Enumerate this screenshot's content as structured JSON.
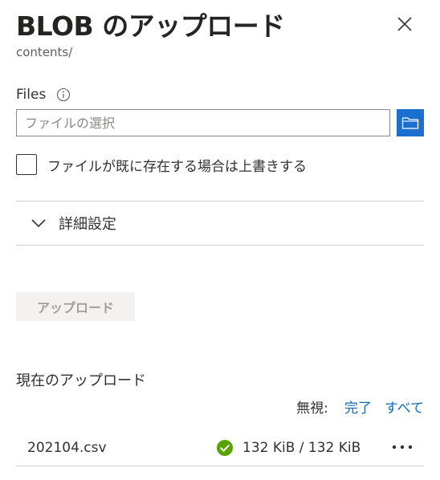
{
  "header": {
    "title": "BLOB のアップロード",
    "subtitle": "contents/",
    "close_icon": "close-icon"
  },
  "files": {
    "label": "Files",
    "info_icon": "info-icon",
    "placeholder": "ファイルの選択",
    "value": "",
    "browse_icon": "folder-icon",
    "accent_color": "#1a6fd0"
  },
  "overwrite": {
    "label": "ファイルが既に存在する場合は上書きする",
    "checked": false
  },
  "advanced": {
    "label": "詳細設定",
    "expanded": false,
    "chevron_icon": "chevron-down-icon"
  },
  "upload_button": {
    "label": "アップロード",
    "enabled": false
  },
  "current_uploads": {
    "title": "現在のアップロード",
    "dismiss_label": "無視:",
    "dismiss_completed": "完了",
    "dismiss_all": "すべて",
    "items": [
      {
        "name": "202104.csv",
        "status": "completed",
        "status_icon": "check-circle-icon",
        "status_color": "#57a300",
        "progress": "132 KiB / 132 KiB",
        "more_icon": "more-icon"
      }
    ]
  }
}
